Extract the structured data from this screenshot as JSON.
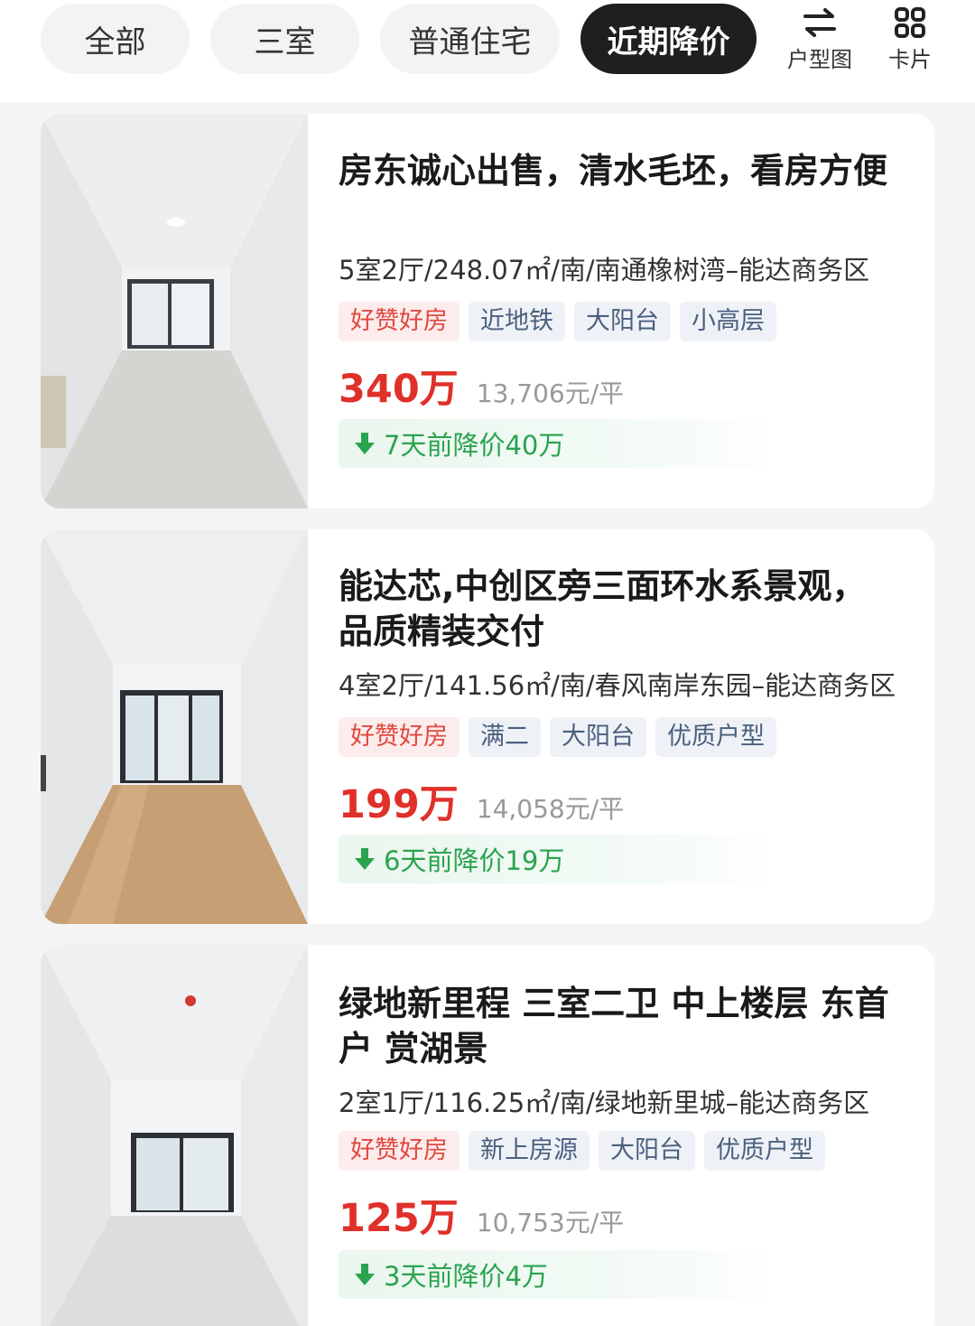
{
  "filters": {
    "chips": [
      {
        "label": "全部",
        "active": false
      },
      {
        "label": "三室",
        "active": false
      },
      {
        "label": "普通住宅",
        "active": false
      },
      {
        "label": "近期降价",
        "active": true
      }
    ],
    "tools": [
      {
        "label": "户型图",
        "icon": "swap-arrows-icon"
      },
      {
        "label": "卡片",
        "icon": "grid-icon"
      }
    ]
  },
  "listings": [
    {
      "title": "房东诚心出售，清水毛坯，看房方便",
      "meta": "5室2厅/248.07㎡/南/南通橡树湾–能达商务区",
      "tags": [
        "好赞好房",
        "近地铁",
        "大阳台",
        "小高层"
      ],
      "price": "340万",
      "unit_price": "13,706元/平",
      "drop": "7天前降价40万"
    },
    {
      "title": "能达芯,中创区旁三面环水系景观，品质精装交付",
      "meta": "4室2厅/141.56㎡/南/春风南岸东园–能达商务区",
      "tags": [
        "好赞好房",
        "满二",
        "大阳台",
        "优质户型"
      ],
      "price": "199万",
      "unit_price": "14,058元/平",
      "drop": "6天前降价19万"
    },
    {
      "title": "绿地新里程  三室二卫  中上楼层 东首户 赏湖景",
      "meta": "2室1厅/116.25㎡/南/绿地新里城–能达商务区",
      "tags": [
        "好赞好房",
        "新上房源",
        "大阳台",
        "优质户型"
      ],
      "price": "125万",
      "unit_price": "10,753元/平",
      "drop": "3天前降价4万"
    }
  ],
  "colors": {
    "price": "#e0302a",
    "drop": "#2aa34f",
    "hot_tag": "#e0483f",
    "tag": "#4a5f7e",
    "active_chip": "#1f1f1f"
  }
}
